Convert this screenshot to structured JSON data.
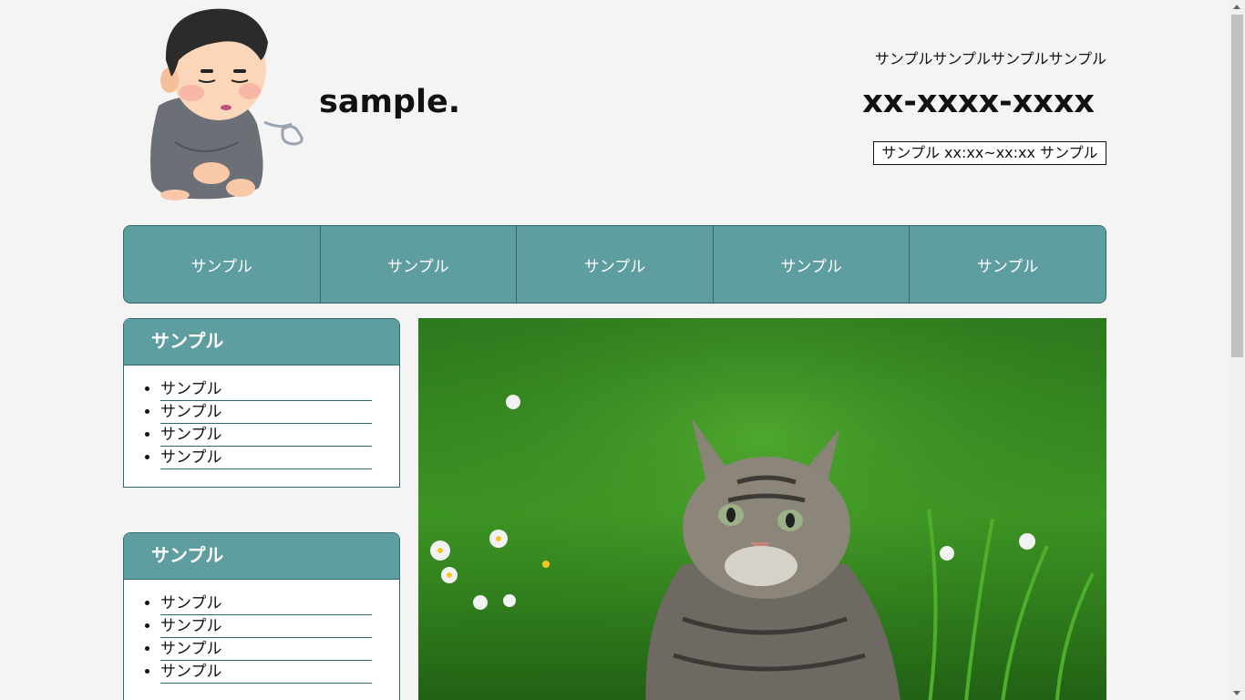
{
  "header": {
    "site_title": "sample.",
    "tagline": "サンプルサンプルサンプルサンプル",
    "phone": "xx-xxxx-xxxx",
    "hours": "サンプル xx:xx~xx:xx サンプル",
    "logo_icon": "sighing-boy-illustration"
  },
  "nav": {
    "items": [
      {
        "label": "サンプル"
      },
      {
        "label": "サンプル"
      },
      {
        "label": "サンプル"
      },
      {
        "label": "サンプル"
      },
      {
        "label": "サンプル"
      }
    ]
  },
  "sidebar": {
    "boxes": [
      {
        "title": "サンプル",
        "items": [
          "サンプル",
          "サンプル",
          "サンプル",
          "サンプル"
        ]
      },
      {
        "title": "サンプル",
        "items": [
          "サンプル",
          "サンプル",
          "サンプル",
          "サンプル"
        ]
      }
    ]
  },
  "main": {
    "hero_icon": "tabby-cat-in-grass-photo"
  },
  "colors": {
    "accent": "#5f9ea0",
    "accent_border": "#2f6b6e",
    "background": "#f4f4f4"
  }
}
